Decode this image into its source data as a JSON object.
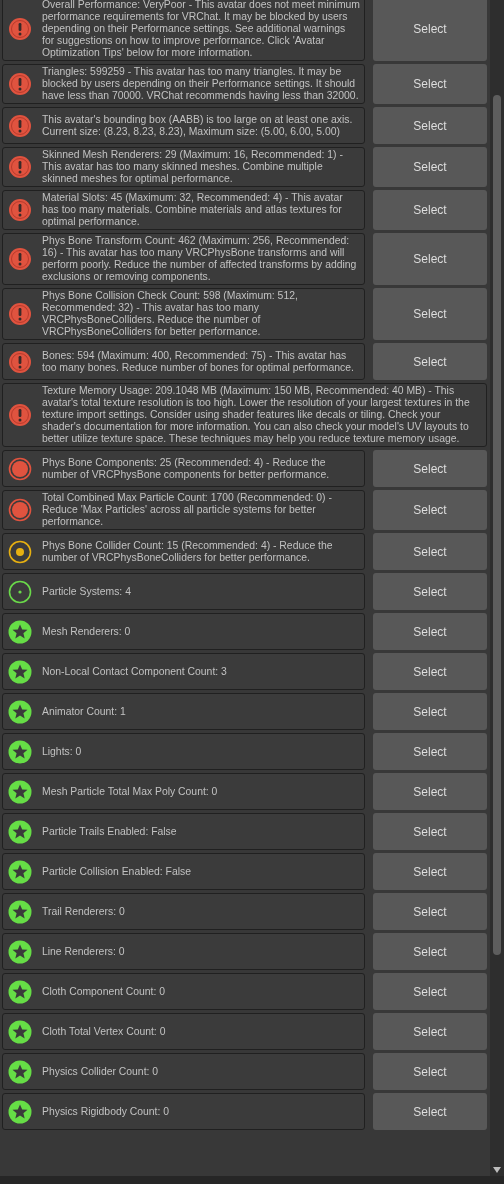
{
  "messages": [
    {
      "kind": "error",
      "text": "Overall Performance: VeryPoor - This avatar does not meet minimum performance requirements for VRChat. It may be blocked by users depending on their Performance settings. See additional warnings for suggestions on how to improve performance. Click 'Avatar Optimization Tips' below for more information.",
      "button": "Select"
    },
    {
      "kind": "error",
      "text": "Triangles: 599259 - This avatar has too many triangles. It may be blocked by users depending on their Performance settings. It should have less than 70000. VRChat recommends having less than 32000.",
      "button": "Select"
    },
    {
      "kind": "error",
      "text": "This avatar's bounding box (AABB) is too large on at least one axis. Current size: (8.23, 8.23, 8.23), Maximum size: (5.00, 6.00, 5.00)",
      "button": "Select"
    },
    {
      "kind": "error",
      "text": "Skinned Mesh Renderers: 29 (Maximum: 16, Recommended: 1) - This avatar has too many skinned meshes. Combine multiple skinned meshes for optimal performance.",
      "button": "Select"
    },
    {
      "kind": "error",
      "text": "Material Slots: 45 (Maximum: 32, Recommended: 4) - This avatar has too many materials. Combine materials and atlas textures for optimal performance.",
      "button": "Select"
    },
    {
      "kind": "error",
      "text": "Phys Bone Transform Count: 462 (Maximum: 256, Recommended: 16) - This avatar has too many VRCPhysBone transforms and will perform poorly. Reduce the number of affected transforms by adding exclusions or removing components.",
      "button": "Select"
    },
    {
      "kind": "error",
      "text": "Phys Bone Collision Check Count: 598 (Maximum: 512, Recommended: 32) - This avatar has too many VRCPhysBoneColliders. Reduce the number of VRCPhysBoneColliders for better performance.",
      "button": "Select"
    },
    {
      "kind": "error",
      "text": "Bones: 594 (Maximum: 400, Recommended: 75) - This avatar has too many bones. Reduce number of bones for optimal performance.",
      "button": "Select"
    },
    {
      "kind": "error",
      "text": "Texture Memory Usage: 209.1048 MB (Maximum: 150 MB, Recommended: 40 MB) - This avatar's total texture resolution is too high. Lower the resolution of your largest textures in the texture import settings. Consider using shader features like decals or tiling. Check your shader's documentation for more information. You can also check your model's UV layouts to better utilize texture space. These techniques may help you reduce texture memory usage."
    },
    {
      "kind": "poor",
      "text": "Phys Bone Components: 25 (Recommended: 4) - Reduce the number of VRCPhysBone components for better performance.",
      "button": "Select"
    },
    {
      "kind": "poor",
      "text": "Total Combined Max Particle Count: 1700 (Recommended: 0) - Reduce 'Max Particles' across all particle systems for better performance.",
      "button": "Select"
    },
    {
      "kind": "medium",
      "text": "Phys Bone Collider Count: 15 (Recommended: 4) - Reduce the number of VRCPhysBoneColliders for better performance.",
      "button": "Select"
    },
    {
      "kind": "good",
      "text": "Particle Systems: 4",
      "button": "Select"
    },
    {
      "kind": "excellent",
      "text": "Mesh Renderers: 0",
      "button": "Select"
    },
    {
      "kind": "excellent",
      "text": "Non-Local Contact Component Count: 3",
      "button": "Select"
    },
    {
      "kind": "excellent",
      "text": "Animator Count: 1",
      "button": "Select"
    },
    {
      "kind": "excellent",
      "text": "Lights: 0",
      "button": "Select"
    },
    {
      "kind": "excellent",
      "text": "Mesh Particle Total Max Poly Count: 0",
      "button": "Select"
    },
    {
      "kind": "excellent",
      "text": "Particle Trails Enabled: False",
      "button": "Select"
    },
    {
      "kind": "excellent",
      "text": "Particle Collision Enabled: False",
      "button": "Select"
    },
    {
      "kind": "excellent",
      "text": "Trail Renderers: 0",
      "button": "Select"
    },
    {
      "kind": "excellent",
      "text": "Line Renderers: 0",
      "button": "Select"
    },
    {
      "kind": "excellent",
      "text": "Cloth Component Count: 0",
      "button": "Select"
    },
    {
      "kind": "excellent",
      "text": "Cloth Total Vertex Count: 0",
      "button": "Select"
    },
    {
      "kind": "excellent",
      "text": "Physics Collider Count: 0",
      "button": "Select"
    },
    {
      "kind": "excellent",
      "text": "Physics Rigidbody Count: 0",
      "button": "Select"
    }
  ]
}
